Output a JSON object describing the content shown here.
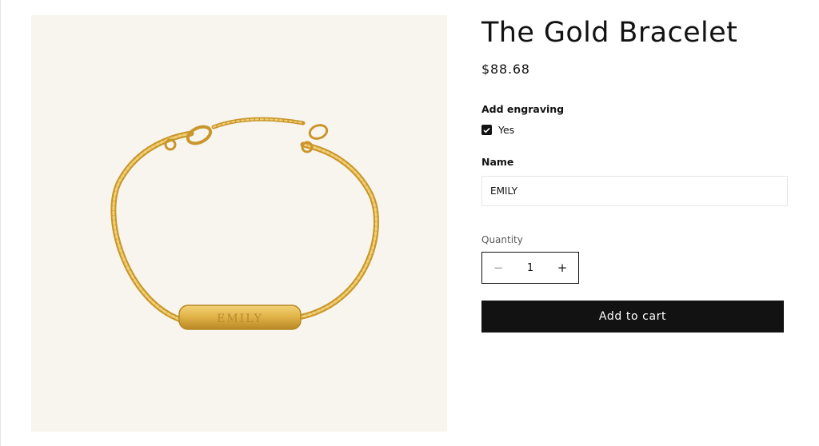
{
  "product": {
    "title": "The Gold Bracelet",
    "price": "$88.68",
    "image": {
      "engraving_text": "EMILY",
      "background": "#f8f5ee",
      "metal_color": "#d9a93a"
    }
  },
  "engraving": {
    "label": "Add engraving",
    "checkbox_label": "Yes",
    "checked": true
  },
  "name_field": {
    "label": "Name",
    "value": "EMILY"
  },
  "quantity": {
    "label": "Quantity",
    "value": "1",
    "minus_symbol": "−",
    "plus_symbol": "+"
  },
  "actions": {
    "add_to_cart": "Add to cart"
  },
  "colors": {
    "text": "#121212",
    "button_bg": "#121212",
    "button_text": "#ffffff"
  }
}
